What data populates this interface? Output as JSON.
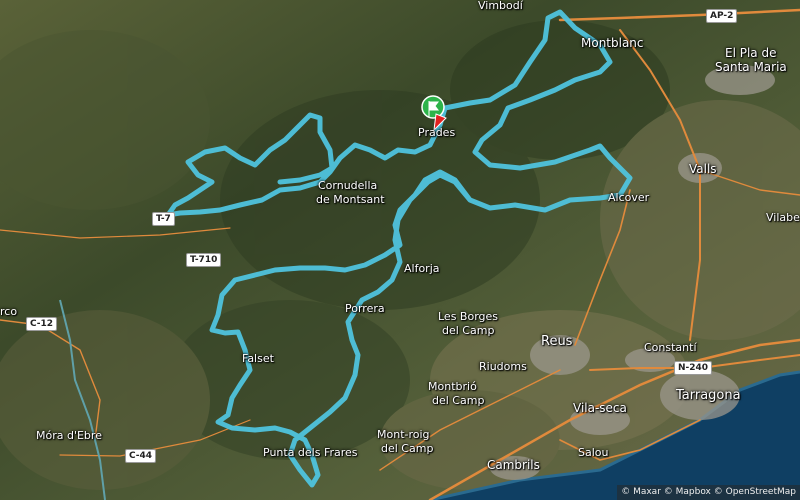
{
  "map": {
    "places": {
      "vimbodi": "Vimbodí",
      "montblanc": "Montblanc",
      "el_pla": "El Pla de",
      "santa_maria": "Santa Maria",
      "prades": "Prades",
      "cornudella": "Cornudella",
      "de_montsant": "de Montsant",
      "valls": "Valls",
      "alcover": "Alcover",
      "vilabella": "Vilabe",
      "alforja": "Alforja",
      "falset": "Falset",
      "porrera": "Porrera",
      "les_borges": "Les Borges",
      "del_camp": "del Camp",
      "riudoms": "Riudoms",
      "reus": "Reus",
      "constanti": "Constantí",
      "montbrio": "Montbrió",
      "montbrio_2": "del Camp",
      "vila_seca": "Vila-seca",
      "tarragona": "Tarragona",
      "mont_roig": "Mont-roig",
      "mont_roig_2": "del Camp",
      "cambrils": "Cambrils",
      "salou": "Salou",
      "punta": "Punta dels Frares",
      "mora": "Móra d'Ebre",
      "marco": "rco"
    },
    "roads": {
      "ap2": "AP-2",
      "t7": "T-7",
      "t710": "T-710",
      "c12": "C-12",
      "c44": "C-44",
      "n240": "N-240"
    },
    "attribution": "© Maxar © Mapbox © OpenStreetMap",
    "route_color": "#4fc3dd",
    "marker_start_color": "#2db34a",
    "marker_end_color": "#e32020"
  }
}
